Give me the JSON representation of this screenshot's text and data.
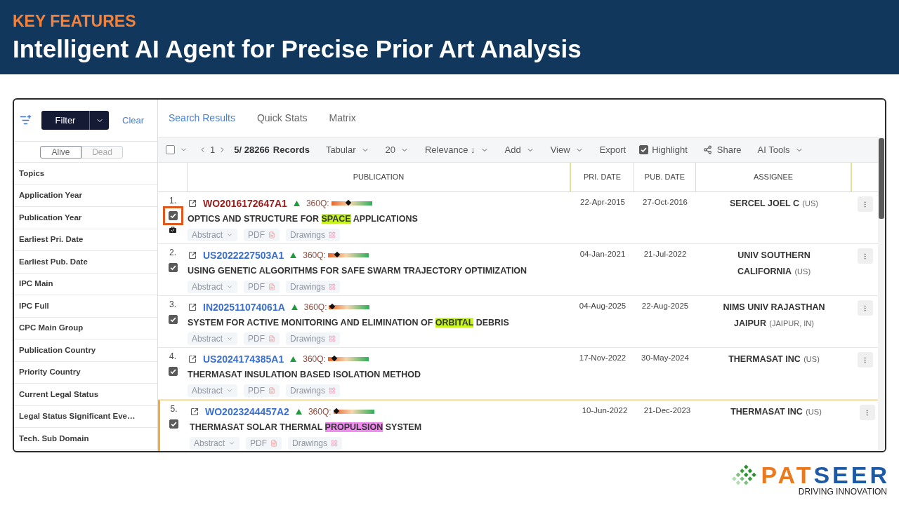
{
  "header": {
    "kicker": "KEY FEATURES",
    "title": "Intelligent AI Agent for Precise Prior Art Analysis"
  },
  "sidebar": {
    "filter_button": "Filter",
    "clear_link": "Clear",
    "status_toggle": [
      {
        "label": "Alive",
        "selected": true
      },
      {
        "label": "Dead",
        "selected": false
      }
    ],
    "items": [
      "Topics",
      "Application Year",
      "Publication Year",
      "Earliest Pri. Date",
      "Earliest Pub. Date",
      "IPC Main",
      "IPC Full",
      "CPC Main Group",
      "Publication Country",
      "Priority Country",
      "Current Legal Status",
      "Legal Status Significant Eve…",
      "Tech. Sub Domain"
    ]
  },
  "tabs": [
    {
      "label": "Search Results",
      "selected": true
    },
    {
      "label": "Quick Stats",
      "selected": false
    },
    {
      "label": "Matrix",
      "selected": false
    }
  ],
  "toolbar": {
    "select_all": {
      "checked": false
    },
    "page": "1",
    "record_count": "5/ 28266",
    "records_label": "Records",
    "controls": [
      {
        "label": "Tabular",
        "kind": "dropdown"
      },
      {
        "label": "20",
        "kind": "dropdown"
      },
      {
        "label": "Relevance ↓",
        "kind": "dropdown"
      },
      {
        "label": "Add",
        "kind": "dropdown"
      },
      {
        "label": "View",
        "kind": "dropdown"
      },
      {
        "label": "Export",
        "kind": "button"
      },
      {
        "label": "Highlight",
        "kind": "checkbox",
        "checked": true
      },
      {
        "label": "Share",
        "kind": "share"
      },
      {
        "label": "AI Tools",
        "kind": "dropdown"
      }
    ]
  },
  "table": {
    "columns": [
      "PUBLICATION",
      "PRI. DATE",
      "PUB. DATE",
      "ASSIGNEE"
    ],
    "rows": [
      {
        "number": "1.",
        "checked": true,
        "focused": true,
        "in_folder": true,
        "current": false,
        "publication_number": "WO2016172647A1",
        "visited": true,
        "quality_label": "360Q:",
        "level": 0.42,
        "title": [
          {
            "text": "OPTICS AND STRUCTURE FOR "
          },
          {
            "text": "SPACE",
            "color": "#c6f41e"
          },
          {
            "text": " APPLICATIONS"
          }
        ],
        "actions": [
          {
            "label": "Abstract",
            "kind": "dropdown",
            "disabled": true
          },
          {
            "label": "PDF",
            "kind": "pdf",
            "disabled": true
          },
          {
            "label": "Drawings",
            "kind": "drawings",
            "disabled": true
          }
        ],
        "priority_date": "22-Apr-2015",
        "publication_date": "27-Oct-2016",
        "assignee": "SERCEL JOEL C",
        "assignee_country": "(US)"
      },
      {
        "number": "2.",
        "checked": true,
        "focused": false,
        "in_folder": false,
        "current": false,
        "publication_number": "US2022227503A1",
        "visited": false,
        "quality_label": "360Q:",
        "level": 0.2,
        "title": [
          {
            "text": "USING GENETIC ALGORITHMS FOR SAFE SWARM TRAJECTORY OPTIMIZATION"
          }
        ],
        "actions": [
          {
            "label": "Abstract",
            "kind": "dropdown",
            "disabled": true
          },
          {
            "label": "PDF",
            "kind": "pdf",
            "disabled": true
          },
          {
            "label": "Drawings",
            "kind": "drawings",
            "disabled": true
          }
        ],
        "priority_date": "04-Jan-2021",
        "publication_date": "21-Jul-2022",
        "assignee": "UNIV SOUTHERN CALIFORNIA",
        "assignee_country": "(US)"
      },
      {
        "number": "3.",
        "checked": true,
        "focused": false,
        "in_folder": false,
        "current": false,
        "publication_number": "IN202511074061A",
        "visited": false,
        "quality_label": "360Q:",
        "level": 0.02,
        "title": [
          {
            "text": "SYSTEM FOR ACTIVE MONITORING AND ELIMINATION OF "
          },
          {
            "text": "ORBITAL",
            "color": "#c6f41e"
          },
          {
            "text": " DEBRIS"
          }
        ],
        "actions": [
          {
            "label": "Abstract",
            "kind": "dropdown",
            "disabled": true
          },
          {
            "label": "PDF",
            "kind": "pdf",
            "disabled": true
          },
          {
            "label": "Drawings",
            "kind": "drawings",
            "disabled": true
          }
        ],
        "priority_date": "04-Aug-2025",
        "publication_date": "22-Aug-2025",
        "assignee": "NIMS UNIV RAJASTHAN JAIPUR",
        "assignee_country": "(JAIPUR, IN)"
      },
      {
        "number": "4.",
        "checked": true,
        "focused": false,
        "in_folder": false,
        "current": false,
        "publication_number": "US2024174385A1",
        "visited": false,
        "quality_label": "360Q:",
        "level": 0.12,
        "title": [
          {
            "text": "THERMASAT INSULATION BASED ISOLATION METHOD"
          }
        ],
        "actions": [
          {
            "label": "Abstract",
            "kind": "dropdown",
            "disabled": true
          },
          {
            "label": "PDF",
            "kind": "pdf",
            "disabled": true
          },
          {
            "label": "Drawings",
            "kind": "drawings",
            "disabled": true
          }
        ],
        "priority_date": "17-Nov-2022",
        "publication_date": "30-May-2024",
        "assignee": "THERMASAT INC",
        "assignee_country": "(US)"
      },
      {
        "number": "5.",
        "checked": true,
        "focused": false,
        "in_folder": false,
        "current": true,
        "publication_number": "WO2023244457A2",
        "visited": false,
        "quality_label": "360Q:",
        "level": 0.02,
        "title": [
          {
            "text": "THERMASAT SOLAR THERMAL "
          },
          {
            "text": "PROPULSION",
            "color": "#f08cf0"
          },
          {
            "text": " SYSTEM"
          }
        ],
        "actions": [
          {
            "label": "Abstract",
            "kind": "dropdown",
            "disabled": true
          },
          {
            "label": "PDF",
            "kind": "pdf",
            "disabled": true
          },
          {
            "label": "Drawings",
            "kind": "drawings",
            "disabled": true
          }
        ],
        "priority_date": "10-Jun-2022",
        "publication_date": "21-Dec-2023",
        "assignee": "THERMASAT INC",
        "assignee_country": "(US)"
      }
    ]
  },
  "logo": {
    "wordmark": [
      {
        "text": "PAT",
        "color": "#e97a1f"
      },
      {
        "text": "SEER",
        "color": "#1d5aa6"
      }
    ],
    "tagline": "DRIVING INNOVATION"
  }
}
